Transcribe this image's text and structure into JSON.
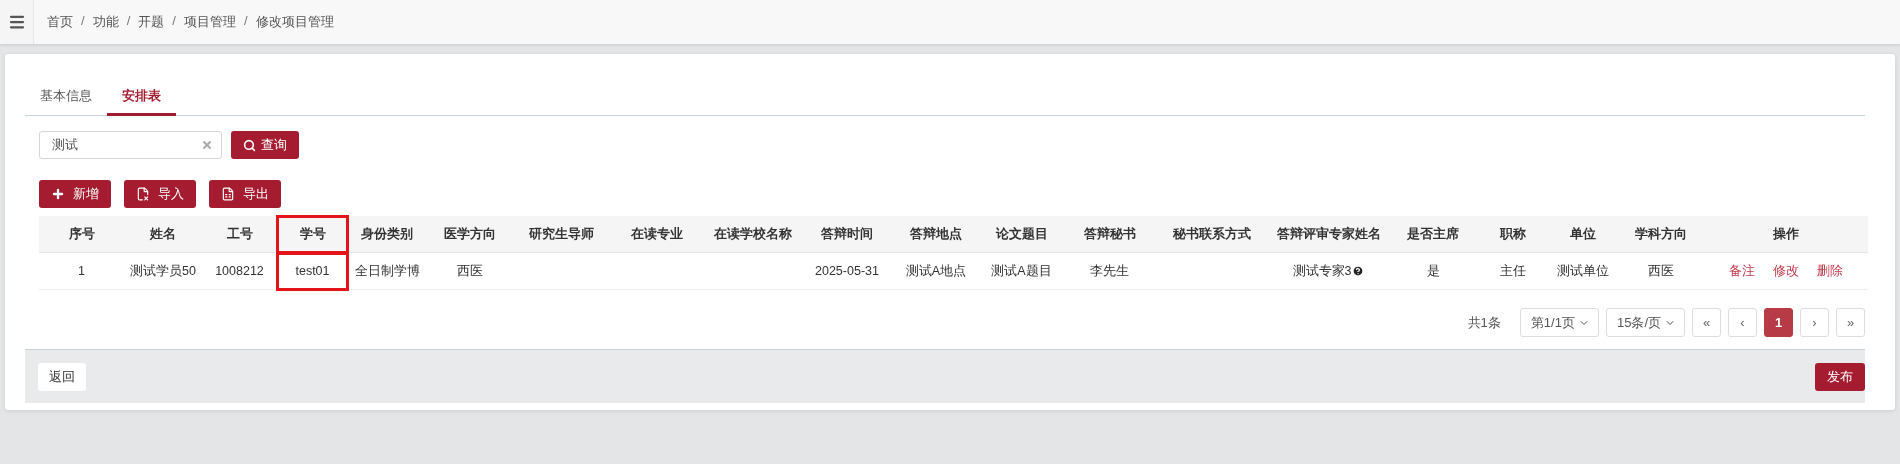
{
  "breadcrumb": [
    "首页",
    "功能",
    "开题",
    "项目管理",
    "修改项目管理"
  ],
  "breadcrumb_separator": "/",
  "tabs": [
    {
      "label": "基本信息",
      "selected": false
    },
    {
      "label": "安排表",
      "selected": true
    }
  ],
  "search": {
    "value": "测试",
    "button": "查询"
  },
  "toolbar": [
    {
      "label": "新增",
      "kind": "add"
    },
    {
      "label": "导入",
      "kind": "import"
    },
    {
      "label": "导出",
      "kind": "export"
    }
  ],
  "table": {
    "columns": [
      {
        "label": "序号",
        "kind": "text",
        "highlighted": false
      },
      {
        "label": "姓名",
        "kind": "text",
        "highlighted": false
      },
      {
        "label": "工号",
        "kind": "text",
        "highlighted": false
      },
      {
        "label": "学号",
        "kind": "text",
        "highlighted": true
      },
      {
        "label": "身份类别",
        "kind": "text",
        "highlighted": false
      },
      {
        "label": "医学方向",
        "kind": "text",
        "highlighted": false
      },
      {
        "label": "研究生导师",
        "kind": "text",
        "highlighted": false
      },
      {
        "label": "在读专业",
        "kind": "text",
        "highlighted": false
      },
      {
        "label": "在读学校名称",
        "kind": "text",
        "highlighted": false
      },
      {
        "label": "答辩时间",
        "kind": "text",
        "highlighted": false
      },
      {
        "label": "答辩地点",
        "kind": "text",
        "highlighted": false
      },
      {
        "label": "论文题目",
        "kind": "text",
        "highlighted": false
      },
      {
        "label": "答辩秘书",
        "kind": "text",
        "highlighted": false
      },
      {
        "label": "秘书联系方式",
        "kind": "text",
        "highlighted": false
      },
      {
        "label": "答辩评审专家姓名",
        "kind": "with_help",
        "highlighted": false
      },
      {
        "label": "是否主席",
        "kind": "text",
        "highlighted": false
      },
      {
        "label": "职称",
        "kind": "text",
        "highlighted": false
      },
      {
        "label": "单位",
        "kind": "text",
        "highlighted": false
      },
      {
        "label": "学科方向",
        "kind": "text",
        "highlighted": false
      },
      {
        "label": "操作",
        "kind": "actions",
        "highlighted": false
      }
    ],
    "rows": [
      {
        "cells": [
          "1",
          "测试学员50",
          "1008212",
          "test01",
          "全日制学博",
          "西医",
          null,
          null,
          null,
          "2025-05-31",
          "测试A地点",
          "测试A题目",
          "李先生",
          null,
          "测试专家3",
          "是",
          "主任",
          "测试单位",
          "西医"
        ],
        "actions": [
          "备注",
          "修改",
          "删除"
        ]
      }
    ]
  },
  "pagination": {
    "total": "共1条",
    "page_select": "第1/1页",
    "size_select": "15条/页",
    "first": "«",
    "prev": "‹",
    "pages": [
      {
        "label": "1",
        "selected": true
      }
    ],
    "next": "›",
    "last": "»"
  },
  "footer": {
    "back": "返回",
    "publish": "发布"
  }
}
